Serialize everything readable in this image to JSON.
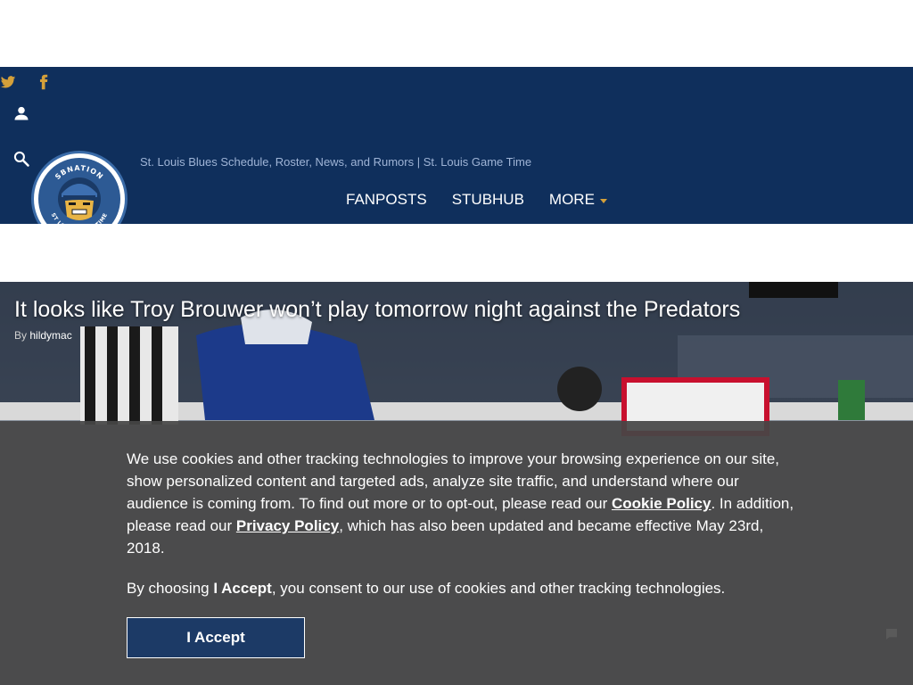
{
  "site": {
    "tagline": "St. Louis Blues Schedule, Roster, News, and Rumors | St. Louis Game Time",
    "logo_text_top": "SBNATION",
    "logo_text_bottom": "ST LOUIS GAME TIME"
  },
  "social": {
    "icons": [
      "twitter-icon",
      "facebook-icon"
    ]
  },
  "nav": {
    "items": [
      {
        "label": "FANPOSTS"
      },
      {
        "label": "STUBHUB"
      },
      {
        "label": "MORE"
      }
    ]
  },
  "article": {
    "headline": "It looks like Troy Brouwer won’t play tomorrow night against the Predators",
    "by_prefix": "By",
    "author": "hildymac"
  },
  "cookie_banner": {
    "text_1": "We use cookies and other tracking technologies to improve your browsing experience on our site, show personalized content and targeted ads, analyze site traffic, and understand where our audience is coming from. To find out more or to opt-out, please read our ",
    "cookie_policy_link": "Cookie Policy",
    "text_2": ". In addition, please read our ",
    "privacy_policy_link": "Privacy Policy",
    "text_3": ", which has also been updated and became effective May 23rd, 2018.",
    "consent_prefix": "By choosing ",
    "consent_bold": "I Accept",
    "consent_suffix": ", you consent to our use of cookies and other tracking technologies.",
    "accept_label": "I Accept"
  },
  "colors": {
    "masthead": "#0f2f5c",
    "accent": "#d4a03a",
    "banner": "#464646",
    "button": "#1c3a66"
  }
}
